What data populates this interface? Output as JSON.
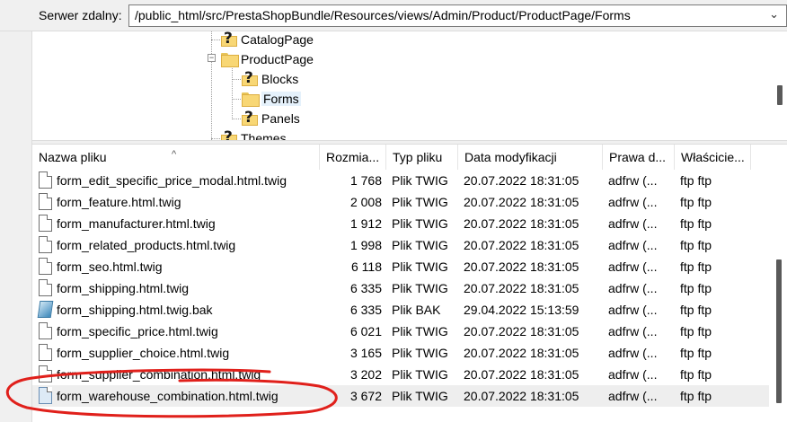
{
  "address_bar": {
    "label": "Serwer zdalny:",
    "path": "/public_html/src/PrestaShopBundle/Resources/views/Admin/Product/ProductPage/Forms",
    "dropdown_icon": "chevron-down-icon"
  },
  "tree": {
    "nodes": [
      {
        "label": "CatalogPage",
        "icon": "folder-question-icon"
      },
      {
        "label": "ProductPage",
        "icon": "folder-icon",
        "expanded": true
      },
      {
        "label": "Blocks",
        "icon": "folder-question-icon"
      },
      {
        "label": "Forms",
        "icon": "folder-icon",
        "selected": true
      },
      {
        "label": "Panels",
        "icon": "folder-question-icon"
      },
      {
        "label": "Themes",
        "icon": "folder-question-icon"
      }
    ]
  },
  "table": {
    "columns": {
      "name": "Nazwa pliku",
      "size": "Rozmia...",
      "type": "Typ pliku",
      "date": "Data modyfikacji",
      "perm": "Prawa d...",
      "owner": "Właścicie..."
    },
    "rows": [
      {
        "name": "form_edit_specific_price_modal.html.twig",
        "size": "1 768",
        "type": "Plik TWIG",
        "date": "20.07.2022 18:31:05",
        "perm": "adfrw (...",
        "owner": "ftp ftp",
        "icon": "file-icon"
      },
      {
        "name": "form_feature.html.twig",
        "size": "2 008",
        "type": "Plik TWIG",
        "date": "20.07.2022 18:31:05",
        "perm": "adfrw (...",
        "owner": "ftp ftp",
        "icon": "file-icon"
      },
      {
        "name": "form_manufacturer.html.twig",
        "size": "1 912",
        "type": "Plik TWIG",
        "date": "20.07.2022 18:31:05",
        "perm": "adfrw (...",
        "owner": "ftp ftp",
        "icon": "file-icon"
      },
      {
        "name": "form_related_products.html.twig",
        "size": "1 998",
        "type": "Plik TWIG",
        "date": "20.07.2022 18:31:05",
        "perm": "adfrw (...",
        "owner": "ftp ftp",
        "icon": "file-icon"
      },
      {
        "name": "form_seo.html.twig",
        "size": "6 118",
        "type": "Plik TWIG",
        "date": "20.07.2022 18:31:05",
        "perm": "adfrw (...",
        "owner": "ftp ftp",
        "icon": "file-icon"
      },
      {
        "name": "form_shipping.html.twig",
        "size": "6 335",
        "type": "Plik TWIG",
        "date": "20.07.2022 18:31:05",
        "perm": "adfrw (...",
        "owner": "ftp ftp",
        "icon": "file-icon"
      },
      {
        "name": "form_shipping.html.twig.bak",
        "size": "6 335",
        "type": "Plik BAK",
        "date": "29.04.2022 15:13:59",
        "perm": "adfrw (...",
        "owner": "ftp ftp",
        "icon": "bak-file-icon"
      },
      {
        "name": "form_specific_price.html.twig",
        "size": "6 021",
        "type": "Plik TWIG",
        "date": "20.07.2022 18:31:05",
        "perm": "adfrw (...",
        "owner": "ftp ftp",
        "icon": "file-icon"
      },
      {
        "name": "form_supplier_choice.html.twig",
        "size": "3 165",
        "type": "Plik TWIG",
        "date": "20.07.2022 18:31:05",
        "perm": "adfrw (...",
        "owner": "ftp ftp",
        "icon": "file-icon"
      },
      {
        "name": "form_supplier_combination.html.twig",
        "size": "3 202",
        "type": "Plik TWIG",
        "date": "20.07.2022 18:31:05",
        "perm": "adfrw (...",
        "owner": "ftp ftp",
        "icon": "file-icon"
      },
      {
        "name": "form_warehouse_combination.html.twig",
        "size": "3 672",
        "type": "Plik TWIG",
        "date": "20.07.2022 18:31:05",
        "perm": "adfrw (...",
        "owner": "ftp ftp",
        "icon": "file-icon",
        "selected": true
      }
    ]
  },
  "colors": {
    "annotation": "#e0201b",
    "folder": "#f8d775",
    "selected_row": "#eeeeee"
  }
}
